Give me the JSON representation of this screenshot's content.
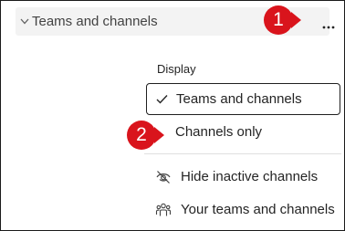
{
  "header": {
    "title": "Teams and channels",
    "more_label": "···"
  },
  "markers": {
    "first": "1",
    "second": "2",
    "color": "#d9141c"
  },
  "menu": {
    "heading": "Display",
    "options": [
      {
        "label": "Teams and channels",
        "selected": true
      },
      {
        "label": "Channels only",
        "selected": false
      }
    ],
    "items": [
      {
        "label": "Hide inactive channels",
        "icon": "eye-off-icon"
      },
      {
        "label": "Your teams and channels",
        "icon": "people-team-icon"
      }
    ]
  }
}
